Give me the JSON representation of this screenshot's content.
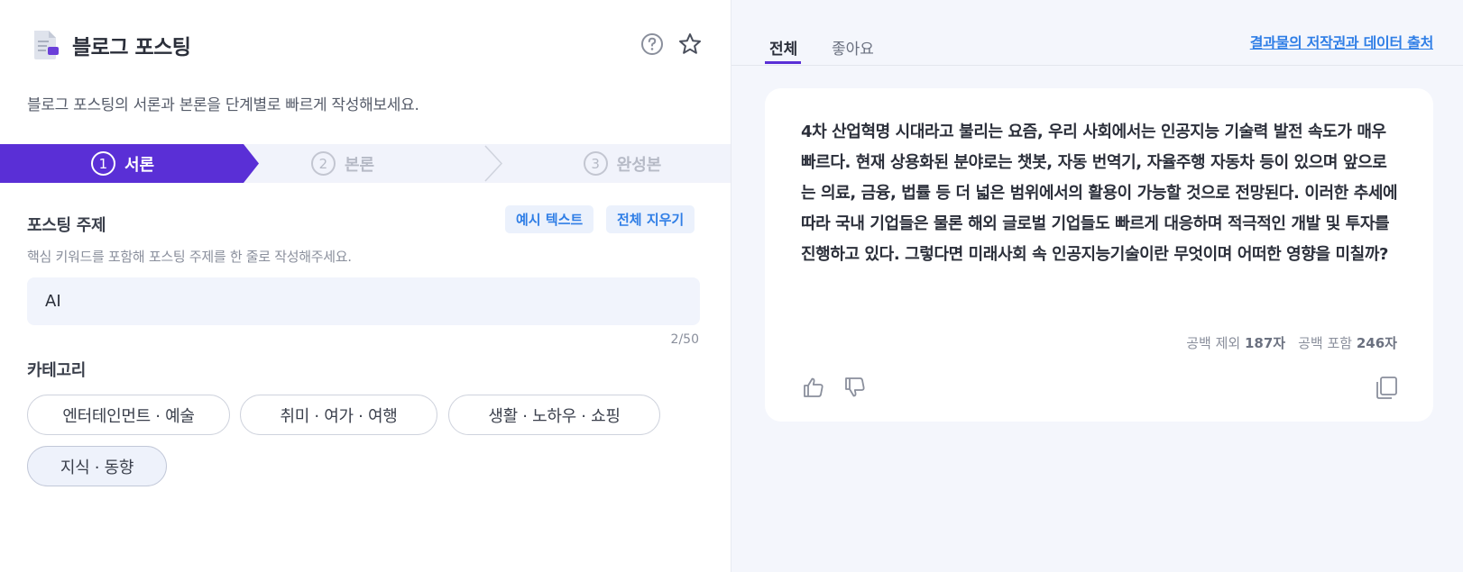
{
  "header": {
    "title": "블로그 포스팅",
    "description": "블로그 포스팅의 서론과 본론을 단계별로 빠르게 작성해보세요."
  },
  "stepper": {
    "steps": [
      {
        "num": "1",
        "label": "서론",
        "active": true
      },
      {
        "num": "2",
        "label": "본론",
        "active": false
      },
      {
        "num": "3",
        "label": "완성본",
        "active": false
      }
    ]
  },
  "topic": {
    "label": "포스팅 주제",
    "example_button": "예시 텍스트",
    "clear_button": "전체 지우기",
    "hint": "핵심 키워드를 포함해 포스팅 주제를 한 줄로 작성해주세요.",
    "value": "AI",
    "counter": "2/50"
  },
  "category": {
    "label": "카테고리",
    "options": [
      {
        "label": "엔터테인먼트 · 예술",
        "selected": false
      },
      {
        "label": "취미 · 여가 · 여행",
        "selected": false
      },
      {
        "label": "생활 · 노하우 · 쇼핑",
        "selected": false
      },
      {
        "label": "지식 · 동향",
        "selected": true
      }
    ]
  },
  "results": {
    "tabs": [
      {
        "label": "전체",
        "active": true
      },
      {
        "label": "좋아요",
        "active": false
      }
    ],
    "source_link": "결과물의 저작권과 데이터 출처",
    "text": "4차 산업혁명 시대라고 불리는 요즘, 우리 사회에서는 인공지능 기술력 발전 속도가 매우 빠르다. 현재 상용화된 분야로는 챗봇, 자동 번역기, 자율주행 자동차 등이 있으며 앞으로는 의료, 금융, 법률 등 더 넓은 범위에서의 활용이 가능할 것으로 전망된다. 이러한 추세에 따라 국내 기업들은 물론 해외 글로벌 기업들도 빠르게 대응하며 적극적인 개발 및 투자를 진행하고 있다. 그렇다면 미래사회 속 인공지능기술이란 무엇이며 어떠한 영향을 미칠까?",
    "count_excl_label": "공백 제외",
    "count_excl_value": "187자",
    "count_incl_label": "공백 포함",
    "count_incl_value": "246자"
  },
  "icons": {
    "doc": "document-icon",
    "help": "help-icon",
    "star": "star-icon",
    "like": "thumbs-up-icon",
    "dislike": "thumbs-down-icon",
    "copy": "copy-icon"
  },
  "colors": {
    "accent": "#5a2fd6",
    "link": "#2f7ee6",
    "panel_bg": "#f4f6fc"
  }
}
